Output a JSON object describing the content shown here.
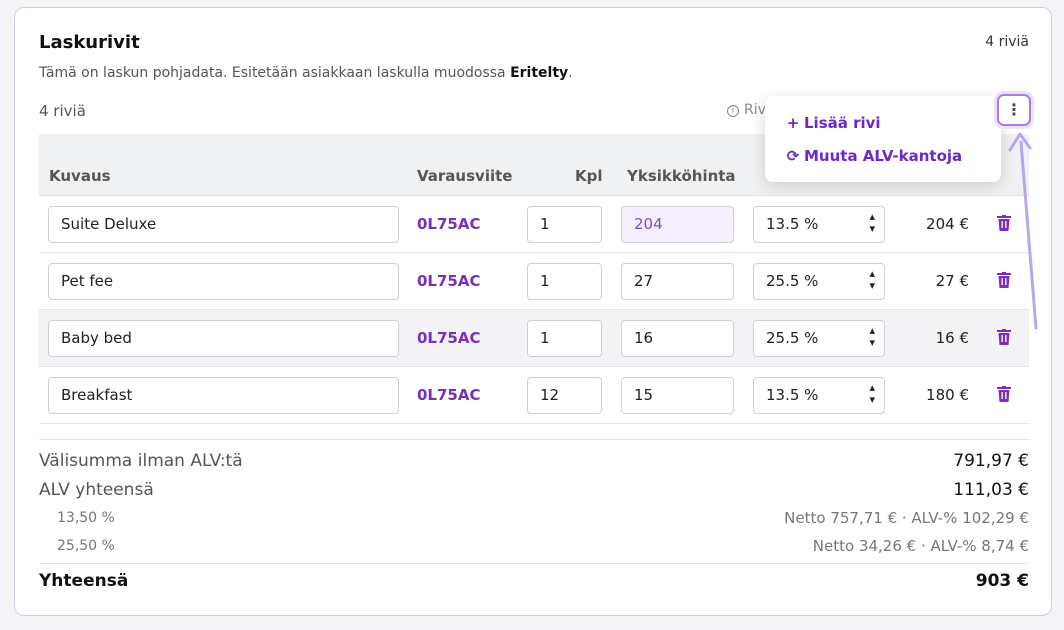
{
  "section": {
    "title": "Laskurivit",
    "top_count": "4 riviä",
    "subtitle_prefix": "Tämä on laskun pohjadata. Esitetään asiakkaan laskulla muodossa ",
    "subtitle_bold": "Eritelty",
    "subtitle_suffix": ".",
    "rows_count": "4 riviä",
    "rivi_label": "Rivi"
  },
  "menu": {
    "items": [
      {
        "icon": "+",
        "label": "Lisää rivi"
      },
      {
        "icon": "⟳",
        "label": "Muuta ALV-kantoja"
      }
    ]
  },
  "table": {
    "headers": {
      "kuvaus": "Kuvaus",
      "varausviite": "Varausviite",
      "kpl": "Kpl",
      "yksikkohinta": "Yksikköhinta"
    },
    "rows": [
      {
        "description": "Suite Deluxe",
        "reference": "0L75AC",
        "qty": "1",
        "unit_price": "204",
        "vat": "13.5 %",
        "total": "204 €"
      },
      {
        "description": "Pet fee",
        "reference": "0L75AC",
        "qty": "1",
        "unit_price": "27",
        "vat": "25.5 %",
        "total": "27 €"
      },
      {
        "description": "Baby bed",
        "reference": "0L75AC",
        "qty": "1",
        "unit_price": "16",
        "vat": "25.5 %",
        "total": "16 €"
      },
      {
        "description": "Breakfast",
        "reference": "0L75AC",
        "qty": "12",
        "unit_price": "15",
        "vat": "13.5 %",
        "total": "180 €"
      }
    ]
  },
  "summary": {
    "subtotal_label": "Välisumma ilman ALV:tä",
    "subtotal_value": "791,97 €",
    "vat_total_label": "ALV yhteensä",
    "vat_total_value": "111,03 €",
    "vat_breakdown": [
      {
        "rate": "13,50 %",
        "detail": "Netto 757,71 € · ALV-% 102,29 €"
      },
      {
        "rate": "25,50 %",
        "detail": "Netto 34,26 € · ALV-% 8,74 €"
      }
    ],
    "grand_label": "Yhteensä",
    "grand_value": "903 €"
  },
  "colors": {
    "accent": "#7b2fb8",
    "border": "#d7c8ee"
  }
}
